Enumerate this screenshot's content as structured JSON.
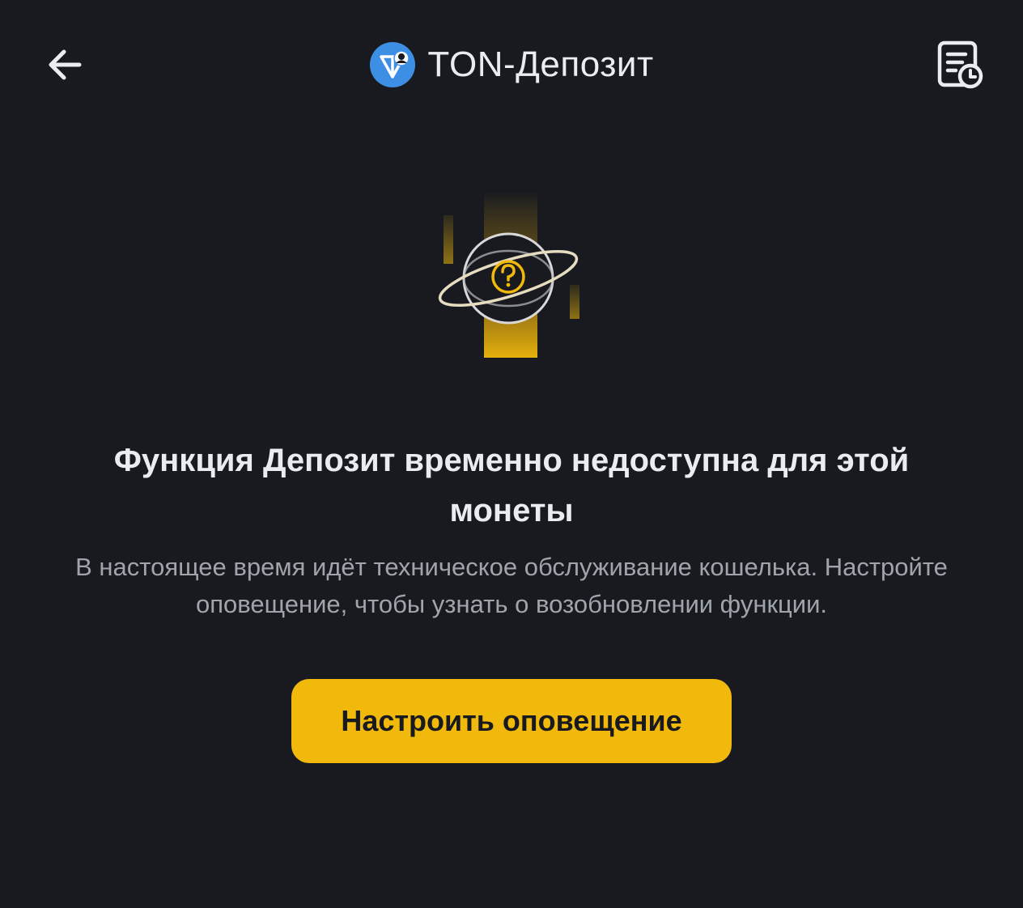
{
  "header": {
    "back_icon": "arrow-left-icon",
    "coin_icon": "ton-coin-icon",
    "title": "TON-Депозит",
    "history_icon": "history-document-icon"
  },
  "illustration": {
    "icon": "question-planet-icon",
    "accent_color": "#f0b90b"
  },
  "message": {
    "title": "Функция Депозит временно недоступна для этой монеты",
    "body": "В настоящее время идёт техническое обслуживание кошелька. Настройте оповещение, чтобы узнать о возобновлении функции."
  },
  "actions": {
    "set_alert_label": "Настроить оповещение"
  },
  "colors": {
    "background": "#181a20",
    "primary": "#f0b90b",
    "text_primary": "#eaecef",
    "text_secondary": "#a0a4ab",
    "ton_blue": "#3d8fe6"
  }
}
